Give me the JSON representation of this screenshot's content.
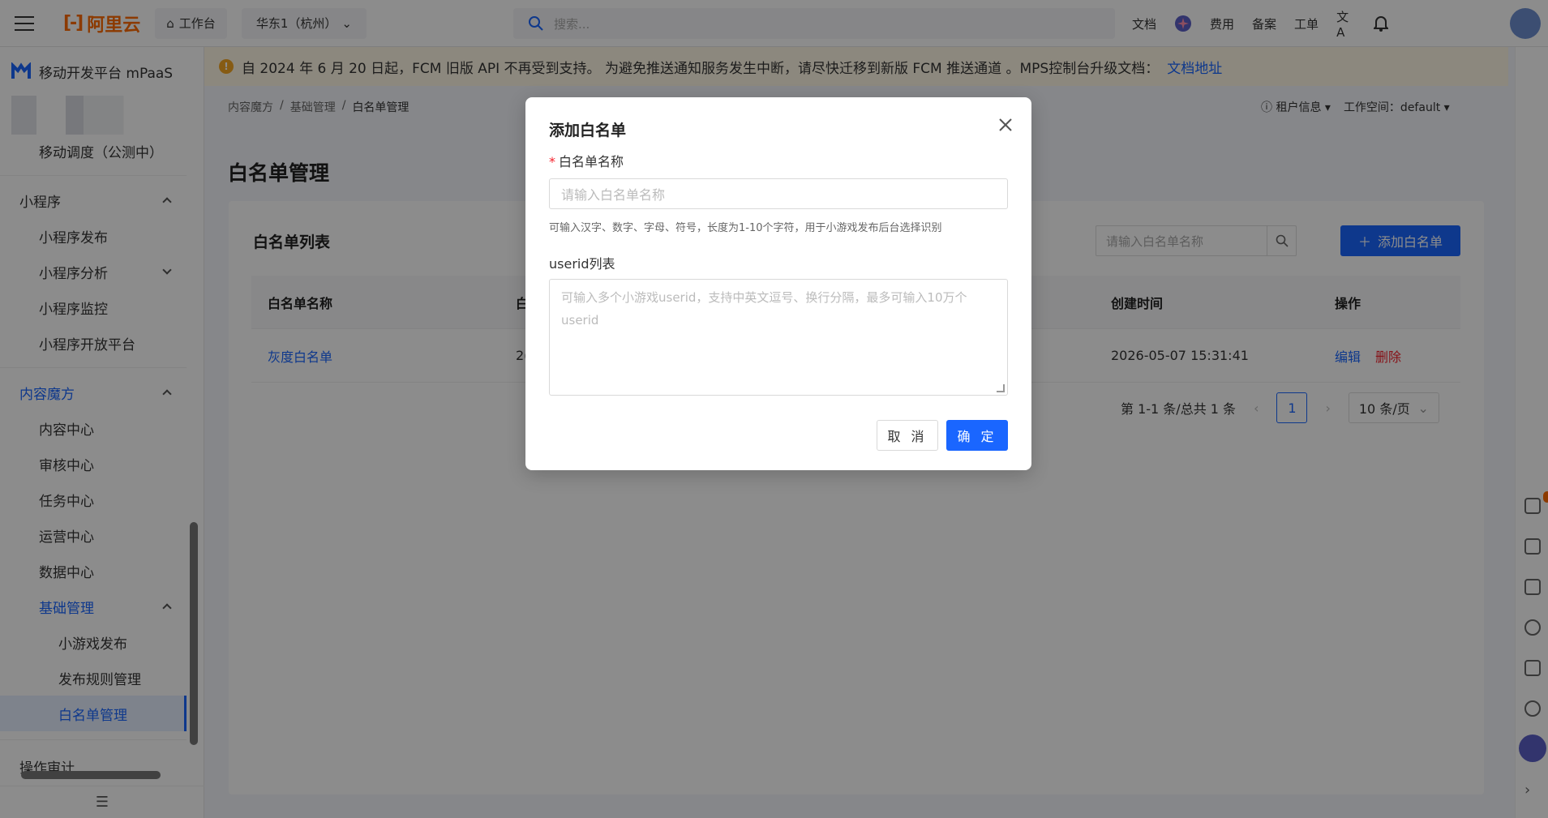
{
  "topbar": {
    "brand": "阿里云",
    "workbench": "工作台",
    "region": "华东1（杭州）",
    "search_placeholder": "搜索...",
    "links": [
      "文档",
      "费用",
      "备案",
      "工单"
    ]
  },
  "sidebar": {
    "product": "移动开发平台 mPaaS",
    "items": [
      {
        "label": "移动调度（公测中）",
        "level": 1
      },
      {
        "label": "小程序",
        "level": 0,
        "expanded": true
      },
      {
        "label": "小程序发布",
        "level": 1
      },
      {
        "label": "小程序分析",
        "level": 1,
        "expanded": false
      },
      {
        "label": "小程序监控",
        "level": 1
      },
      {
        "label": "小程序开放平台",
        "level": 1
      },
      {
        "label": "内容魔方",
        "level": 0,
        "expanded": true
      },
      {
        "label": "内容中心",
        "level": 1
      },
      {
        "label": "审核中心",
        "level": 1
      },
      {
        "label": "任务中心",
        "level": 1
      },
      {
        "label": "运营中心",
        "level": 1
      },
      {
        "label": "数据中心",
        "level": 1
      },
      {
        "label": "基础管理",
        "level": 1,
        "expanded": true
      },
      {
        "label": "小游戏发布",
        "level": 2
      },
      {
        "label": "发布规则管理",
        "level": 2
      },
      {
        "label": "白名单管理",
        "level": 2,
        "selected": true
      },
      {
        "label": "操作审计",
        "level": 0
      }
    ]
  },
  "notice": {
    "text": "自 2024 年 6 月 20 日起，FCM 旧版 API 不再受到支持。 为避免推送通知服务发生中断，请尽快迁移到新版 FCM 推送通道 。MPS控制台升级文档：",
    "link": "文档地址"
  },
  "breadcrumb": [
    "内容魔方",
    "基础管理",
    "白名单管理"
  ],
  "tenant": {
    "info": "租户信息",
    "workspace": "工作空间：default"
  },
  "page_title": "白名单管理",
  "card": {
    "title": "白名单列表",
    "search_placeholder": "请输入白名单名称",
    "add_button": "添加白名单",
    "columns": [
      "白名单名称",
      "白",
      "创建时间",
      "操作"
    ],
    "rows": [
      {
        "name": "灰度白名单",
        "col2": "2(",
        "created": "2026-05-07 15:31:41",
        "edit": "编辑",
        "delete": "删除"
      }
    ],
    "pager": {
      "summary": "第 1-1 条/总共 1 条",
      "page": "1",
      "size": "10 条/页"
    }
  },
  "modal": {
    "title": "添加白名单",
    "name_label": "白名单名称",
    "name_placeholder": "请输入白名单名称",
    "name_help": "可输入汉字、数字、字母、符号，长度为1-10个字符，用于小游戏发布后台选择识别",
    "userid_label": "userid列表",
    "userid_placeholder": "可输入多个小游戏userid，支持中英文逗号、换行分隔，最多可输入10万个userid",
    "cancel": "取 消",
    "ok": "确 定"
  },
  "colors": {
    "primary": "#1a66ff",
    "brand": "#ff6a00",
    "danger": "#f5222d",
    "notice_bg": "#fff8e6"
  }
}
